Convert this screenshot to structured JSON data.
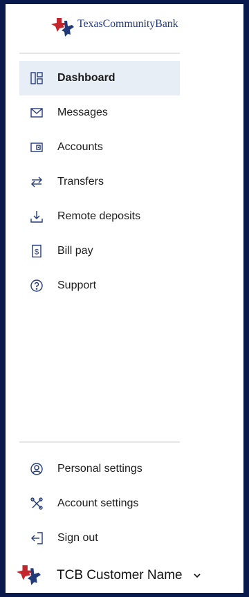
{
  "brand": {
    "name": "TexasCommunityBank",
    "primary_color": "#233a7a",
    "accent_color": "#c4262e"
  },
  "nav": {
    "items": [
      {
        "label": "Dashboard",
        "icon": "dashboard-icon",
        "active": true
      },
      {
        "label": "Messages",
        "icon": "envelope-icon"
      },
      {
        "label": "Accounts",
        "icon": "wallet-icon"
      },
      {
        "label": "Transfers",
        "icon": "transfer-arrows-icon"
      },
      {
        "label": "Remote deposits",
        "icon": "download-tray-icon"
      },
      {
        "label": "Bill pay",
        "icon": "dollar-bill-icon"
      },
      {
        "label": "Support",
        "icon": "question-circle-icon"
      }
    ]
  },
  "bottom": {
    "items": [
      {
        "label": "Personal settings",
        "icon": "user-circle-icon"
      },
      {
        "label": "Account settings",
        "icon": "tools-icon"
      },
      {
        "label": "Sign out",
        "icon": "sign-out-icon"
      }
    ]
  },
  "user": {
    "name": "TCB Customer Name",
    "chevron_icon": "chevron-down-icon"
  }
}
